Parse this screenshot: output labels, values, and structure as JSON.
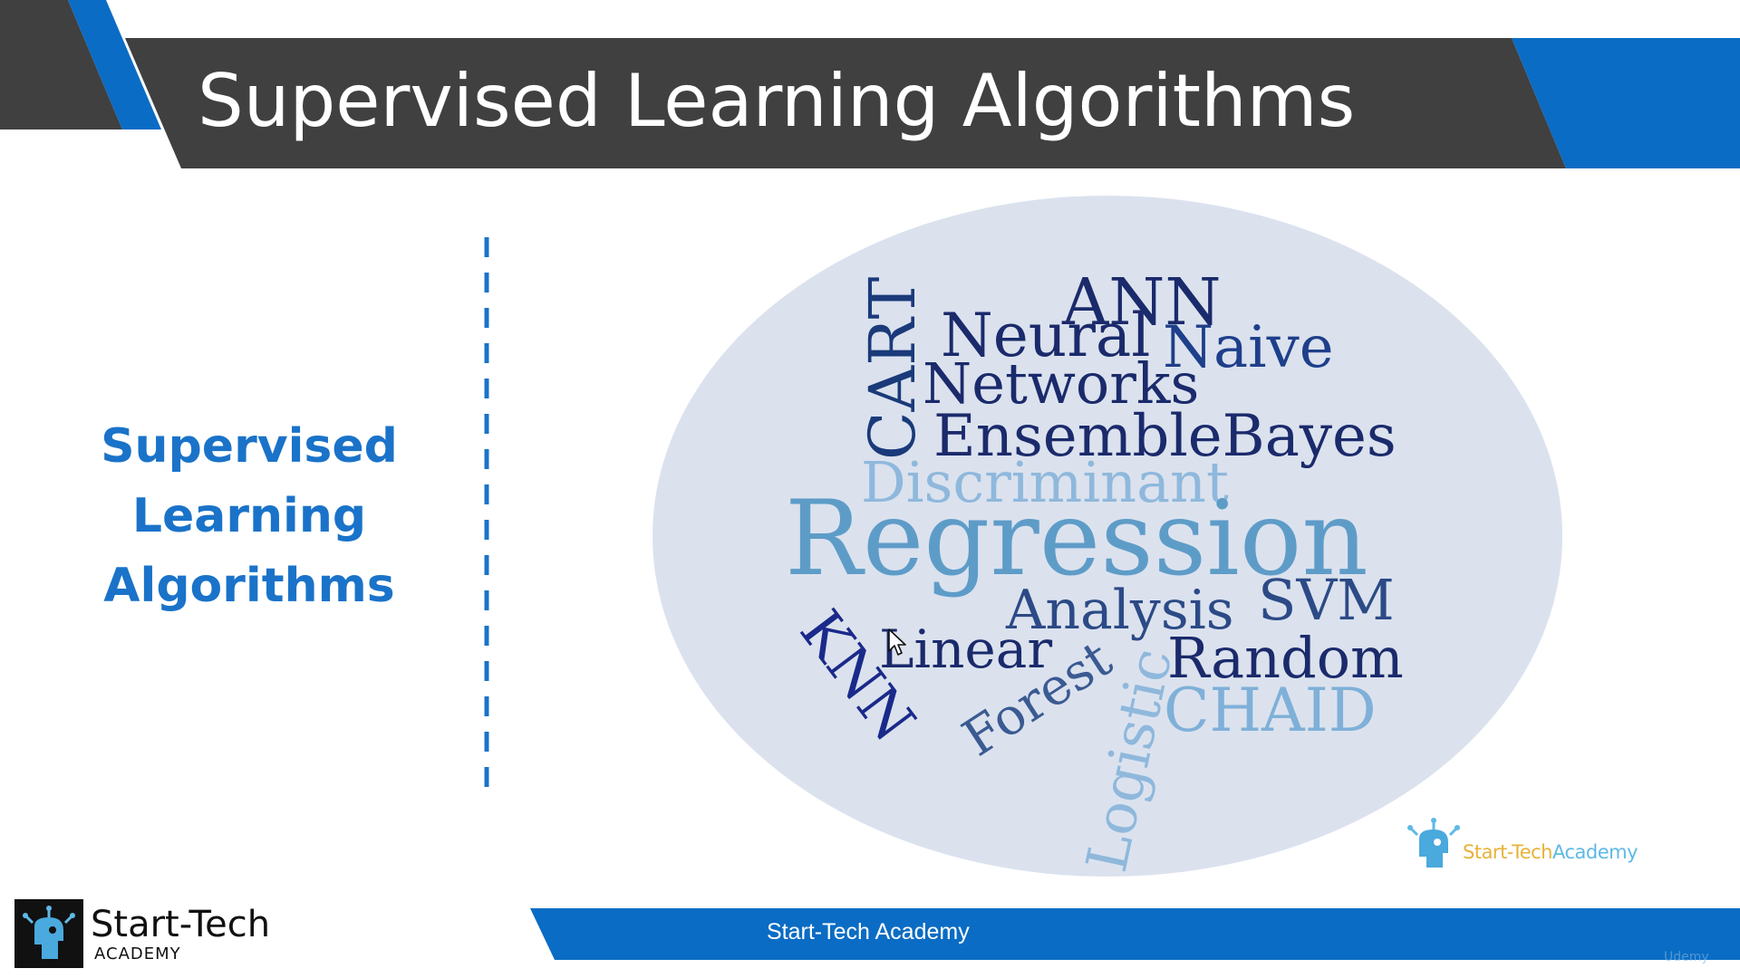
{
  "slide": {
    "title": "Supervised Learning Algorithms",
    "section_heading": [
      "Supervised",
      "Learning",
      "Algorithms"
    ],
    "footer_text": "Start-Tech Academy",
    "watermark": "Udemy"
  },
  "word_cloud": {
    "words": [
      {
        "text": "ANN",
        "color": "#1a2a6b"
      },
      {
        "text": "CART",
        "color": "#1a3a7a"
      },
      {
        "text": "Neural",
        "color": "#1a2a6b"
      },
      {
        "text": "Naive",
        "color": "#1e3f8a"
      },
      {
        "text": "Networks",
        "color": "#1a2a6b"
      },
      {
        "text": "EnsembleBayes",
        "color": "#1a2a6b"
      },
      {
        "text": "Discriminant",
        "color": "#8fb8dc"
      },
      {
        "text": "Regression",
        "color": "#5e9cc8"
      },
      {
        "text": "Analysis",
        "color": "#2c4a86"
      },
      {
        "text": "SVM",
        "color": "#2c4a86"
      },
      {
        "text": "KNN",
        "color": "#1a2a8a"
      },
      {
        "text": "Linear",
        "color": "#1a2a6b"
      },
      {
        "text": "Random",
        "color": "#1a2a6b"
      },
      {
        "text": "Forest",
        "color": "#3a5a92"
      },
      {
        "text": "Logistic",
        "color": "#8fb8dc"
      },
      {
        "text": "CHAID",
        "color": "#7fb0d8"
      }
    ],
    "logo": {
      "part1": "Start-Tech",
      "part2": "Academy"
    }
  },
  "brand": {
    "name": "Start-Tech",
    "subtitle": "ACADEMY"
  },
  "colors": {
    "title_band": "#404040",
    "accent_blue": "#0a6cc4",
    "cloud_fill": "#dbe2ee",
    "heading": "#1a73c9",
    "divider": "#1a73c9"
  },
  "icons": {
    "brand_logo": "robot-head-icon",
    "cloud_logo": "robot-head-icon",
    "cursor": "mouse-pointer-icon"
  }
}
